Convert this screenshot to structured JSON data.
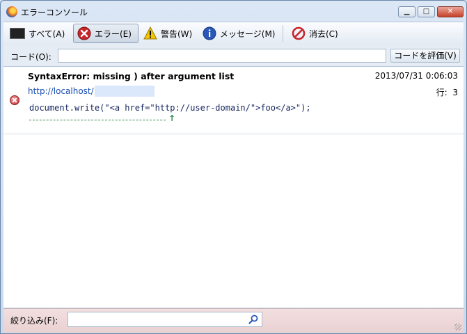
{
  "window": {
    "title": "エラーコンソール"
  },
  "toolbar": {
    "all": "すべて(A)",
    "errors": "エラー(E)",
    "warnings": "警告(W)",
    "messages": "メッセージ(M)",
    "clear": "消去(C)"
  },
  "codebar": {
    "label": "コード(O):",
    "eval_button": "コードを評価(V)",
    "value": ""
  },
  "entries": [
    {
      "message": "SyntaxError: missing ) after argument list",
      "timestamp": "2013/07/31 0:06:03",
      "source": "http://localhost/",
      "line_label": "行:",
      "line": "3",
      "code": "document.write(\"<a href=\"http://user-domain/\">foo</a>\");",
      "caret": "↑"
    }
  ],
  "filter": {
    "label": "絞り込み(F):",
    "value": ""
  },
  "colors": {
    "error": "#c8262b",
    "link": "#1a4fb5",
    "caret": "#2a8a4a"
  }
}
